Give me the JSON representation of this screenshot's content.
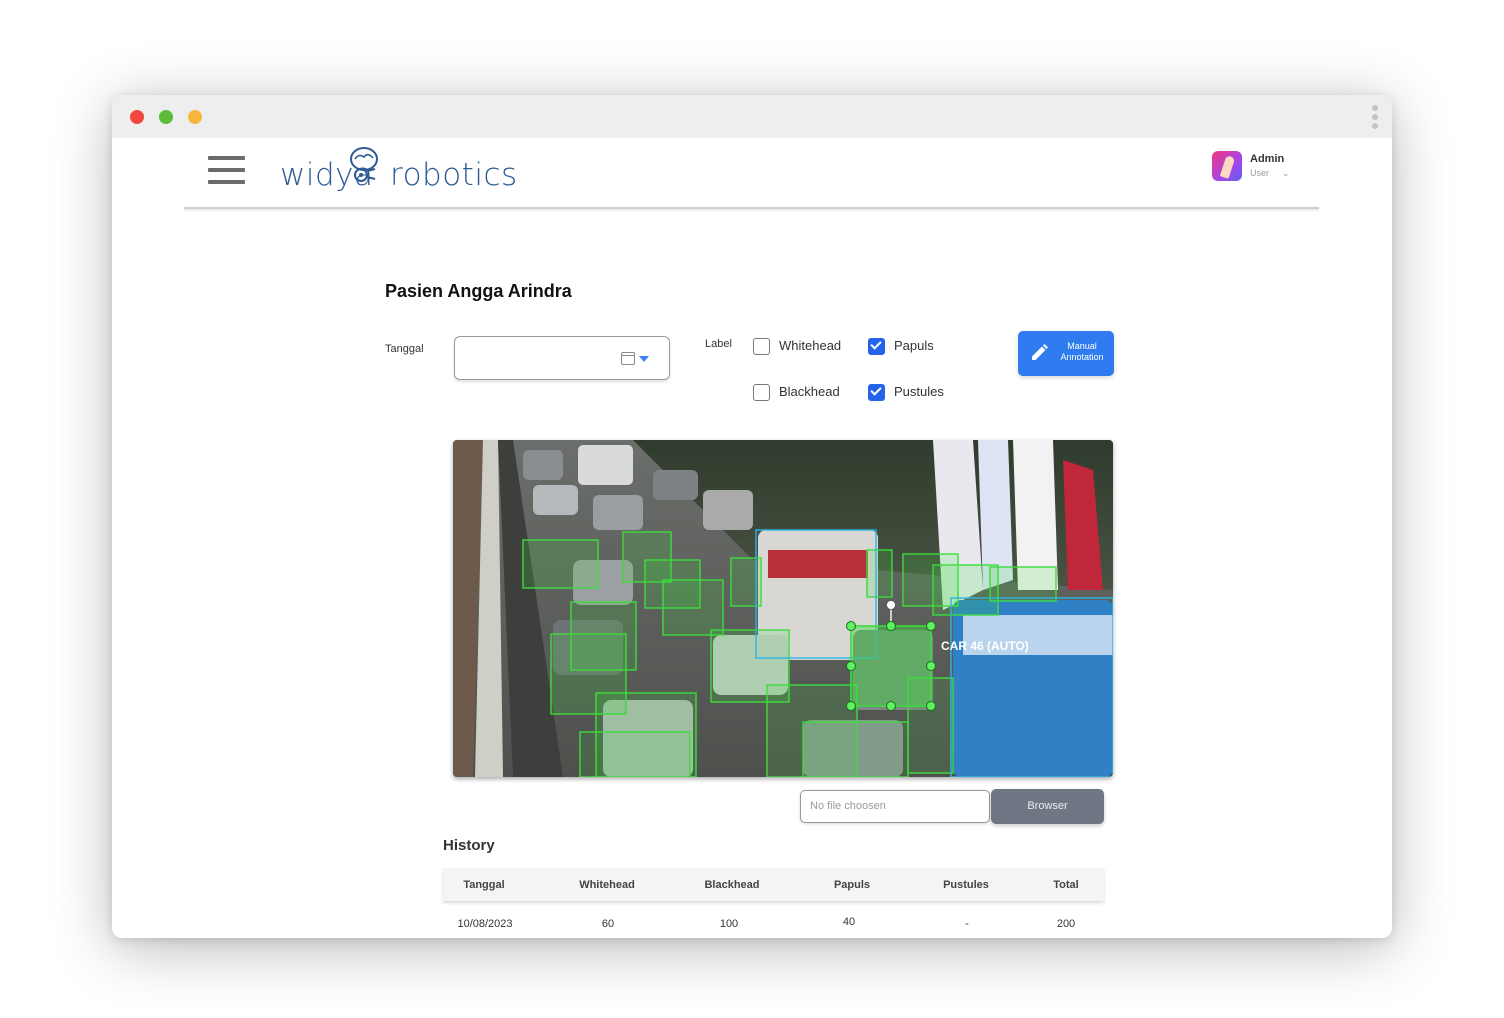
{
  "brand": {
    "logo_left": "widya",
    "logo_right": "robotics"
  },
  "user": {
    "name": "Admin",
    "role": "User"
  },
  "page": {
    "title": "Pasien Angga Arindra"
  },
  "filters": {
    "date_label": "Tanggal",
    "date_value": "",
    "label_heading": "Label",
    "options": [
      {
        "label": "Whitehead",
        "checked": false
      },
      {
        "label": "Papuls",
        "checked": true
      },
      {
        "label": "Blackhead",
        "checked": false
      },
      {
        "label": "Pustules",
        "checked": true
      }
    ]
  },
  "manual_button": {
    "line1": "Manual",
    "line2": "Annotation"
  },
  "annotation": {
    "selected_label": "CAR 46 (AUTO)"
  },
  "upload": {
    "placeholder": "No file choosen",
    "browse_label": "Browser"
  },
  "history": {
    "title": "History",
    "columns": [
      "Tanggal",
      "Whitehead",
      "Blackhead",
      "Papuls",
      "Pustules",
      "Total"
    ],
    "rows": [
      [
        "10/08/2023",
        "60",
        "100",
        "40",
        "-",
        "200"
      ]
    ]
  },
  "colors": {
    "accent": "#2f7bf0",
    "box_green": "#3ddc3d",
    "box_blue": "#2bb7e6",
    "logo": "#2c5a93"
  }
}
